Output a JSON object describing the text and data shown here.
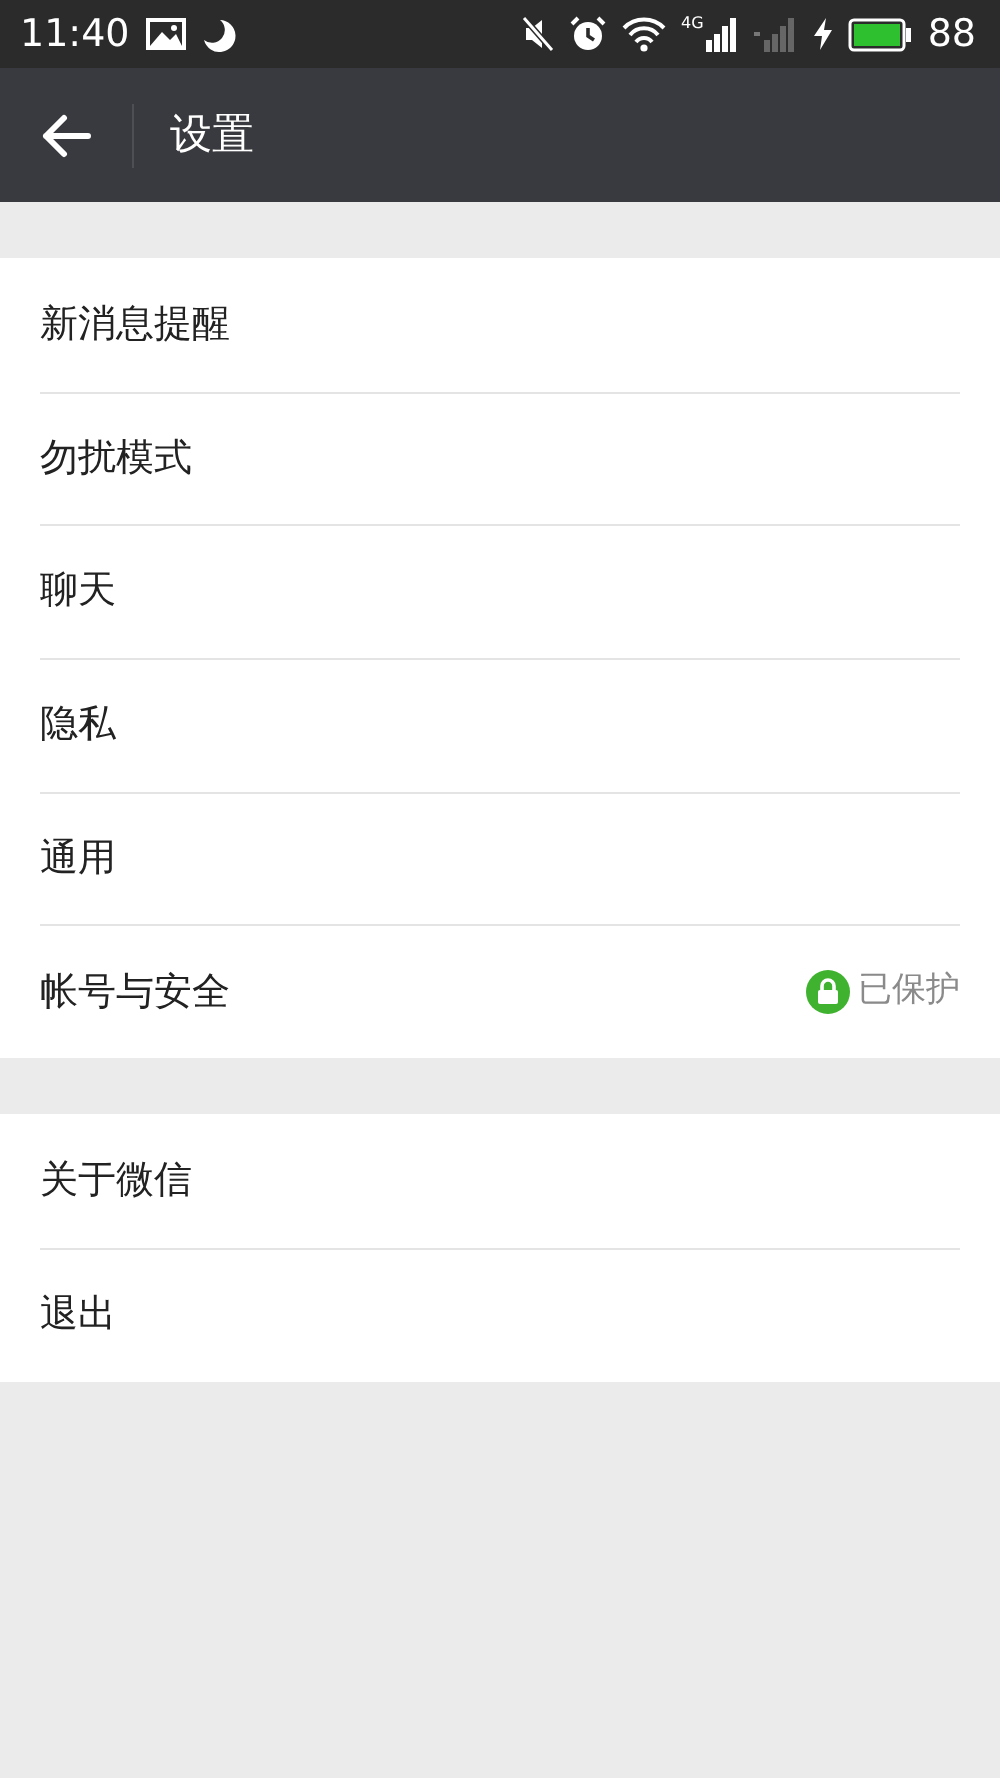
{
  "status_bar": {
    "time": "11:40",
    "network_type": "4G",
    "battery": "88"
  },
  "header": {
    "title": "设置"
  },
  "groups": [
    {
      "items": [
        {
          "label": "新消息提醒"
        },
        {
          "label": "勿扰模式"
        },
        {
          "label": "聊天"
        },
        {
          "label": "隐私"
        },
        {
          "label": "通用"
        },
        {
          "label": "帐号与安全",
          "status": "已保护"
        }
      ]
    },
    {
      "items": [
        {
          "label": "关于微信"
        },
        {
          "label": "退出"
        }
      ]
    }
  ]
}
